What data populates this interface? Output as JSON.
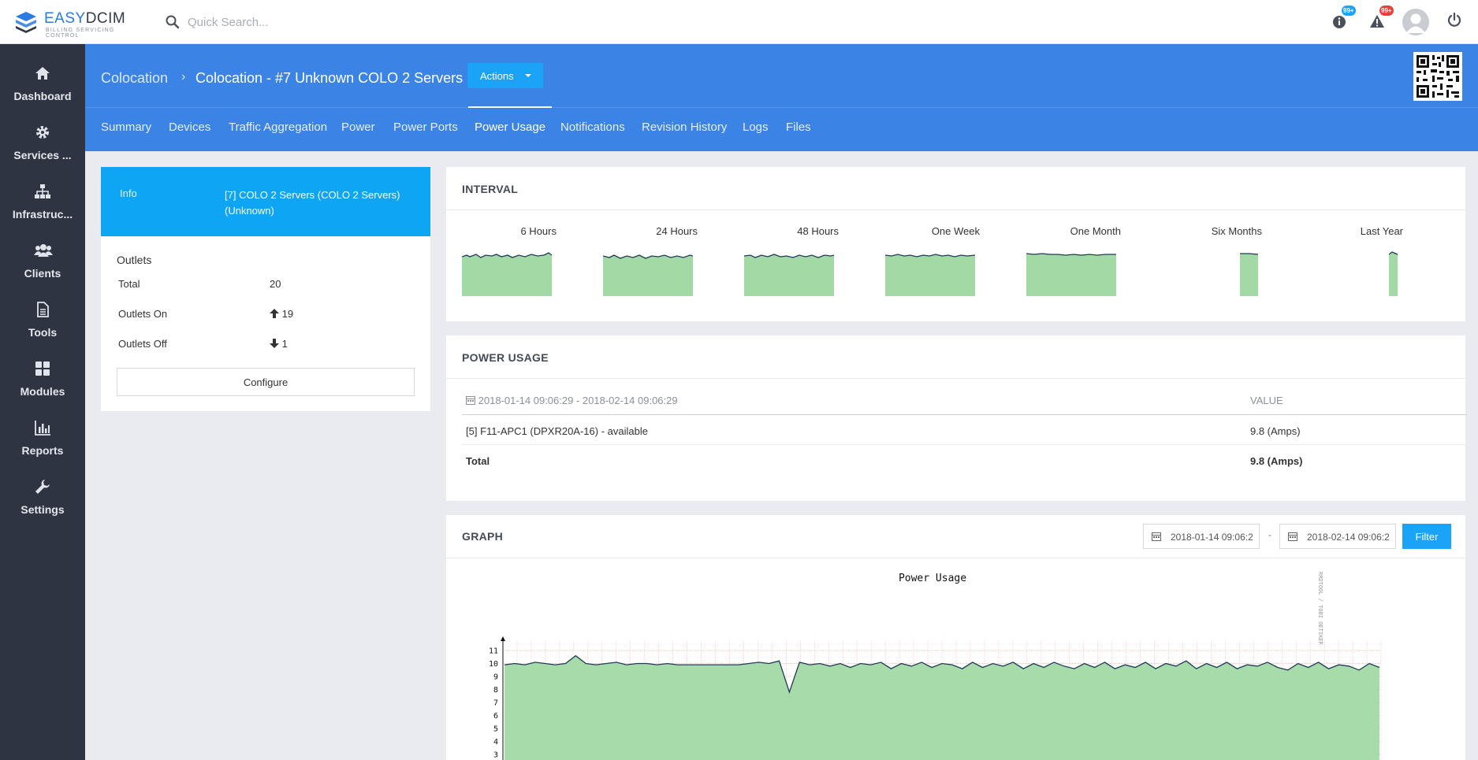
{
  "app": {
    "brand_easy": "EASY",
    "brand_dcim": "DCIM",
    "tagline": "BILLING SERVICING CONTROL",
    "search_placeholder": "Quick Search...",
    "info_badge": "99+",
    "alert_badge": "99+"
  },
  "sidebar": {
    "items": [
      {
        "label": "Dashboard",
        "icon": "home-icon"
      },
      {
        "label": "Services ...",
        "icon": "gear-icon"
      },
      {
        "label": "Infrastruc...",
        "icon": "sitemap-icon"
      },
      {
        "label": "Clients",
        "icon": "users-icon"
      },
      {
        "label": "Tools",
        "icon": "file-icon"
      },
      {
        "label": "Modules",
        "icon": "grid-icon"
      },
      {
        "label": "Reports",
        "icon": "bar-chart-icon"
      },
      {
        "label": "Settings",
        "icon": "wrench-icon"
      }
    ]
  },
  "header": {
    "breadcrumb_root": "Colocation",
    "breadcrumb_separator": "›",
    "title": "Colocation - #7 Unknown COLO 2 Servers",
    "actions_label": "Actions"
  },
  "tabs": [
    {
      "label": "Summary",
      "active": false
    },
    {
      "label": "Devices",
      "active": false
    },
    {
      "label": "Traffic Aggregation",
      "active": false
    },
    {
      "label": "Power",
      "active": false
    },
    {
      "label": "Power Ports",
      "active": false
    },
    {
      "label": "Power Usage",
      "active": true
    },
    {
      "label": "Notifications",
      "active": false
    },
    {
      "label": "Revision History",
      "active": false
    },
    {
      "label": "Logs",
      "active": false
    },
    {
      "label": "Files",
      "active": false
    }
  ],
  "info": {
    "key": "Info",
    "value": "[7] COLO 2 Servers (COLO 2 Servers) (Unknown)"
  },
  "outlets": {
    "title": "Outlets",
    "total_label": "Total",
    "total_value": "20",
    "on_label": "Outlets On",
    "on_value": "19",
    "off_label": "Outlets Off",
    "off_value": "1",
    "configure_label": "Configure"
  },
  "interval": {
    "title": "INTERVAL",
    "items": [
      "6 Hours",
      "24 Hours",
      "48 Hours",
      "One Week",
      "One Month",
      "Six Months",
      "Last Year"
    ]
  },
  "power_usage": {
    "title": "POWER USAGE",
    "range_header": "2018-01-14 09:06:29 - 2018-02-14 09:06:29",
    "value_header": "VALUE",
    "rows": [
      {
        "name": "[5] F11-APC1 (DPXR20A-16) - available",
        "value": "9.8 (Amps)"
      }
    ],
    "total_label": "Total",
    "total_value": "9.8 (Amps)"
  },
  "graph": {
    "title": "GRAPH",
    "from": "2018-01-14 09:06:2",
    "to": "2018-02-14 09:06:2",
    "dash": "-",
    "filter_label": "Filter"
  },
  "chart_data": {
    "type": "area",
    "title": "Power Usage",
    "side_label": "RRDTOOL / TOBI OETIKER",
    "yticks": [
      3,
      4,
      5,
      6,
      7,
      8,
      9,
      10,
      11
    ],
    "series": [
      {
        "values": [
          9.9,
          10.0,
          9.9,
          10.1,
          10.0,
          9.9,
          10.0,
          10.6,
          10.0,
          9.9,
          10.0,
          10.1,
          9.9,
          10.0,
          10.0,
          9.9,
          10.0,
          9.9,
          9.9,
          9.9,
          9.9,
          9.9,
          9.9,
          9.9,
          10.0,
          10.1,
          10.0,
          10.2,
          7.8,
          10.1,
          9.9,
          10.0,
          9.8,
          10.0,
          9.7,
          10.0,
          9.9,
          10.1,
          9.6,
          10.0,
          9.8,
          10.1,
          9.7,
          10.0,
          9.9,
          9.6,
          10.1,
          9.7,
          10.0,
          9.8,
          10.1,
          9.6,
          10.0,
          9.7,
          10.1,
          9.8,
          9.6,
          10.0,
          9.7,
          10.1,
          9.6,
          9.9,
          9.7,
          10.1,
          9.6,
          10.0,
          9.8,
          10.2,
          9.6,
          10.0,
          9.7,
          10.1,
          9.6,
          9.9,
          9.8,
          10.1,
          9.7,
          9.5,
          10.0,
          9.7,
          10.1,
          9.6,
          9.9,
          9.8,
          9.5,
          10.0,
          9.7
        ]
      }
    ]
  }
}
